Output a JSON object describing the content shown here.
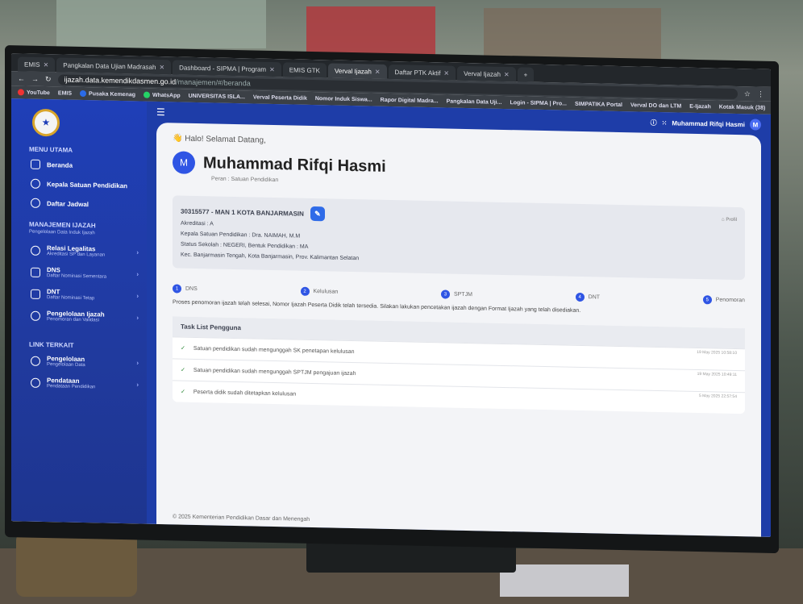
{
  "browser": {
    "tabs": [
      {
        "label": "EMIS"
      },
      {
        "label": "Pangkalan Data Ujian Madrasah"
      },
      {
        "label": "Dashboard - SIPMA | Program"
      },
      {
        "label": "EMIS GTK"
      },
      {
        "label": "Verval Ijazah"
      },
      {
        "label": "Daftar PTK Aktif"
      },
      {
        "label": "Verval Ijazah"
      }
    ],
    "url": "ijazah.data.kemendikdasmen.go.id",
    "url_path": "/manajemen/#/beranda",
    "bookmarks": [
      "YouTube",
      "EMIS",
      "Pusaka Kemenag",
      "WhatsApp",
      "UNIVERSITAS ISLA...",
      "Verval Peserta Didik",
      "Nomor Induk Siswa...",
      "Rapor Digital Madra...",
      "Pangkalan Data Uji...",
      "Login - SIPMA | Pro...",
      "SIMPATIKA Portal",
      "Verval DO dan LTM",
      "E-Ijazah",
      "Kotak Masuk (38)"
    ]
  },
  "sidebar": {
    "menu_utama": "MENU UTAMA",
    "items": [
      {
        "label": "Beranda"
      },
      {
        "label": "Kepala Satuan Pendidikan"
      },
      {
        "label": "Daftar Jadwal"
      }
    ],
    "manajemen": "MANAJEMEN IJAZAH",
    "manajemen_sub": "Pengelolaan Data Induk Ijazah",
    "manajemen_items": [
      {
        "label": "Relasi Legalitas",
        "sub": "Akreditasi SP dan Layanan"
      },
      {
        "label": "DNS",
        "sub": "Daftar Nominasi Sementara"
      },
      {
        "label": "DNT",
        "sub": "Daftar Nominasi Tetap"
      },
      {
        "label": "Pengelolaan Ijazah",
        "sub": "Penomoran dan Validasi"
      }
    ],
    "link_terkait": "LINK TERKAIT",
    "links": [
      {
        "label": "Pengelolaan",
        "sub": "Pengelolaan Data"
      },
      {
        "label": "Pendataan",
        "sub": "Pendataan Pendidikan"
      }
    ]
  },
  "topbar": {
    "user": "Muhammad Rifqi Hasmi",
    "initial": "M"
  },
  "main": {
    "greeting": "Halo! Selamat Datang,",
    "name": "Muhammad Rifqi Hasmi",
    "initial": "M",
    "role": "Peran : Satuan Pendidikan",
    "school": "30315577 - MAN 1 KOTA BANJARMASIN",
    "profile": "Profil",
    "akreditasi": "Akreditasi : A",
    "kepala": "Kepala Satuan Pendidikan : Dra. NAIMAH, M.M",
    "status": "Status Sekolah : NEGERI, Bentuk Pendidikan : MA",
    "alamat": "Kec. Banjarmasin Tengah, Kota Banjarmasin, Prov. Kalimantan Selatan",
    "steps": [
      {
        "n": "1",
        "label": "DNS"
      },
      {
        "n": "2",
        "label": "Kelulusan"
      },
      {
        "n": "3",
        "label": "SPTJM"
      },
      {
        "n": "4",
        "label": "DNT"
      },
      {
        "n": "5",
        "label": "Penomoran"
      }
    ],
    "message": "Proses penomoran ijazah telah selesai, Nomor Ijazah Peserta Didik telah tersedia. Silakan lakukan pencetakan ijazah dengan Format Ijazah yang telah disediakan.",
    "task_title": "Task List Pengguna",
    "tasks": [
      {
        "text": "Satuan pendidikan sudah mengunggah SK penetapan kelulusan",
        "time": "19 May 2025 10:58:10"
      },
      {
        "text": "Satuan pendidikan sudah mengunggah SPTJM pengajuan ijazah",
        "time": "19 May 2025 10:49:11"
      },
      {
        "text": "Peserta didik sudah ditetapkan kelulusan",
        "time": "5 May 2025 22:57:54"
      }
    ],
    "footer": "© 2025 Kementerian Pendidikan Dasar dan Menengah"
  }
}
